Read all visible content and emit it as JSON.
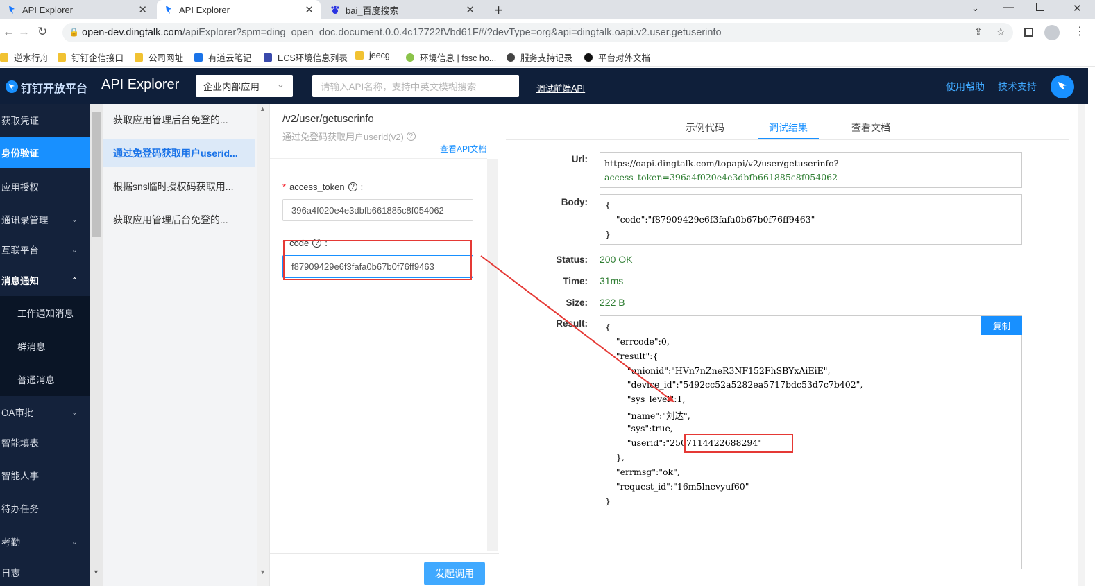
{
  "browser": {
    "tabs": [
      {
        "title": "API Explorer"
      },
      {
        "title": "API Explorer"
      },
      {
        "title": "bai_百度搜索"
      }
    ],
    "new_tab_icon": "plus-icon",
    "url_host": "open-dev.dingtalk.com",
    "url_rest": "/apiExplorer?spm=ding_open_doc.document.0.0.4c17722fVbd61F#/?devType=org&api=dingtalk.oapi.v2.user.getuserinfo",
    "bookmarks": [
      {
        "label": "逆水行舟"
      },
      {
        "label": "钉钉企信接口"
      },
      {
        "label": "公司网址"
      },
      {
        "label": "有道云笔记"
      },
      {
        "label": "ECS环境信息列表"
      },
      {
        "label": "jeecg"
      },
      {
        "label": "环境信息 | fssc ho..."
      },
      {
        "label": "服务支持记录"
      },
      {
        "label": "平台对外文档"
      }
    ]
  },
  "header": {
    "logo_text": "钉钉开放平台",
    "title": "API Explorer",
    "app_type_select": "企业内部应用",
    "search_placeholder": "请输入API名称，支持中英文模糊搜索",
    "debug_link": "调试前端API",
    "help_link": "使用帮助",
    "support_link": "技术支持"
  },
  "sidebar": {
    "items": [
      {
        "label": "获取凭证"
      },
      {
        "label": "身份验证"
      },
      {
        "label": "应用授权"
      },
      {
        "label": "通讯录管理"
      },
      {
        "label": "互联平台"
      },
      {
        "label": "消息通知"
      },
      {
        "label": "工作通知消息"
      },
      {
        "label": "群消息"
      },
      {
        "label": "普通消息"
      },
      {
        "label": "OA审批"
      },
      {
        "label": "智能填表"
      },
      {
        "label": "智能人事"
      },
      {
        "label": "待办任务"
      },
      {
        "label": "考勤"
      },
      {
        "label": "日志"
      }
    ]
  },
  "api_list": {
    "items": [
      {
        "label": "获取应用管理后台免登的..."
      },
      {
        "label": "通过免登码获取用户userid..."
      },
      {
        "label": "根据sns临时授权码获取用..."
      },
      {
        "label": "获取应用管理后台免登的..."
      }
    ]
  },
  "params": {
    "api_path": "/v2/user/getuserinfo",
    "api_desc": "通过免登码获取用户userid(v2)",
    "doc_link": "查看API文档",
    "access_token_label": "access_token",
    "access_token_value": "396a4f020e4e3dbfb661885c8f054062",
    "code_label": "code",
    "code_value": "f87909429e6f3fafa0b67b0f76ff9463",
    "required_mark": "*",
    "colon": ":",
    "submit_button": "发起调用"
  },
  "result_panel": {
    "tabs": [
      "示例代码",
      "调试结果",
      "查看文档"
    ],
    "url_label": "Url:",
    "url_line1": "https://oapi.dingtalk.com/topapi/v2/user/getuserinfo?",
    "url_line2": "access_token=396a4f020e4e3dbfb661885c8f054062",
    "body_label": "Body:",
    "body_lines": [
      "{",
      "    \"code\":\"f87909429e6f3fafa0b67b0f76ff9463\"",
      "}"
    ],
    "status_label": "Status:",
    "status_value": "200 OK",
    "time_label": "Time:",
    "time_value": "31ms",
    "size_label": "Size:",
    "size_value": "222 B",
    "result_label": "Result:",
    "copy_button": "复制",
    "result_lines": [
      "{",
      "    \"errcode\":0,",
      "    \"result\":{",
      "        \"unionid\":\"HVn7nZneR3NF152FhSBYxAiEiE\",",
      "        \"device_id\":\"5492cc52a5282ea5717bdc53d7c7b402\",",
      "        \"sys_level\":1,",
      "        \"name\":\"刘达\",",
      "        \"sys\":true,",
      "        \"userid\":\"2507114422688294\"",
      "    },",
      "    \"errmsg\":\"ok\",",
      "    \"request_id\":\"16m5lnevyuf60\"",
      "}"
    ]
  },
  "colors": {
    "accent": "#1890ff",
    "header_bg": "#0f1f3a",
    "sidebar_bg": "#14223b",
    "annotation": "#e53935",
    "ok_green": "#2e7d32"
  }
}
